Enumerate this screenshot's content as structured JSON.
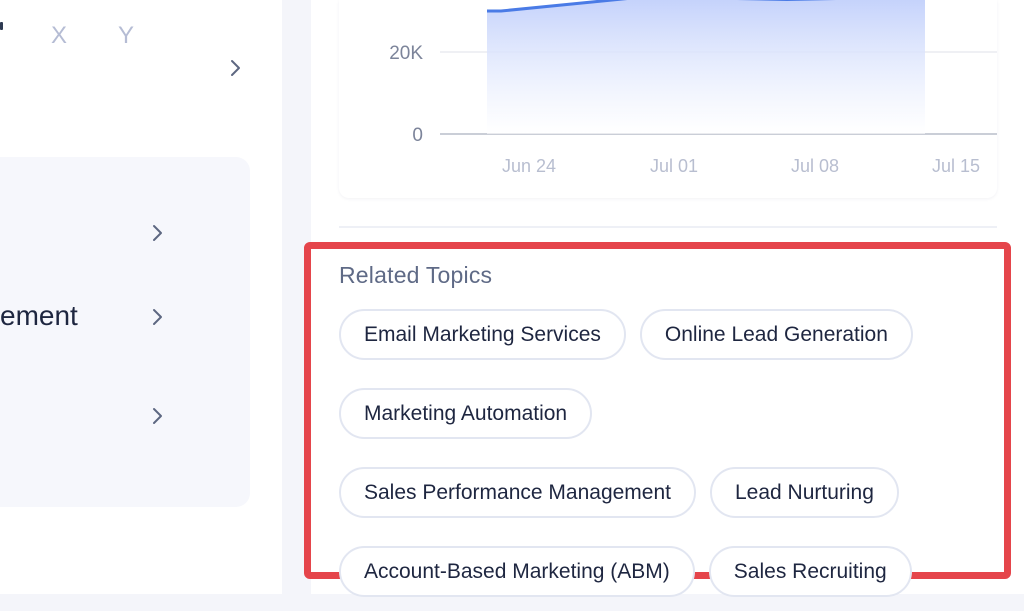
{
  "left_pane": {
    "letters": [
      "X",
      "Y"
    ],
    "partial_label": "ement"
  },
  "chart_data": {
    "type": "area",
    "categories": [
      "Jun 24",
      "Jul 01",
      "Jul 08",
      "Jul 15"
    ],
    "y_ticks": [
      "0",
      "20K"
    ],
    "series": [
      {
        "values": [
          30000,
          33500,
          32800,
          33500
        ]
      }
    ],
    "grid": true
  },
  "related_topics": {
    "title": "Related Topics",
    "rows": [
      [
        "Email Marketing Services",
        "Online Lead Generation"
      ],
      [
        "Marketing Automation"
      ],
      [
        "Sales Performance Management",
        "Lead Nurturing"
      ],
      [
        "Account-Based Marketing (ABM)",
        "Sales Recruiting"
      ]
    ]
  },
  "colors": {
    "accent_line": "#4a7be6",
    "area_fill": "#c9d6fb",
    "highlight_border": "#e5454b",
    "chip_border": "#e2e6f1"
  }
}
